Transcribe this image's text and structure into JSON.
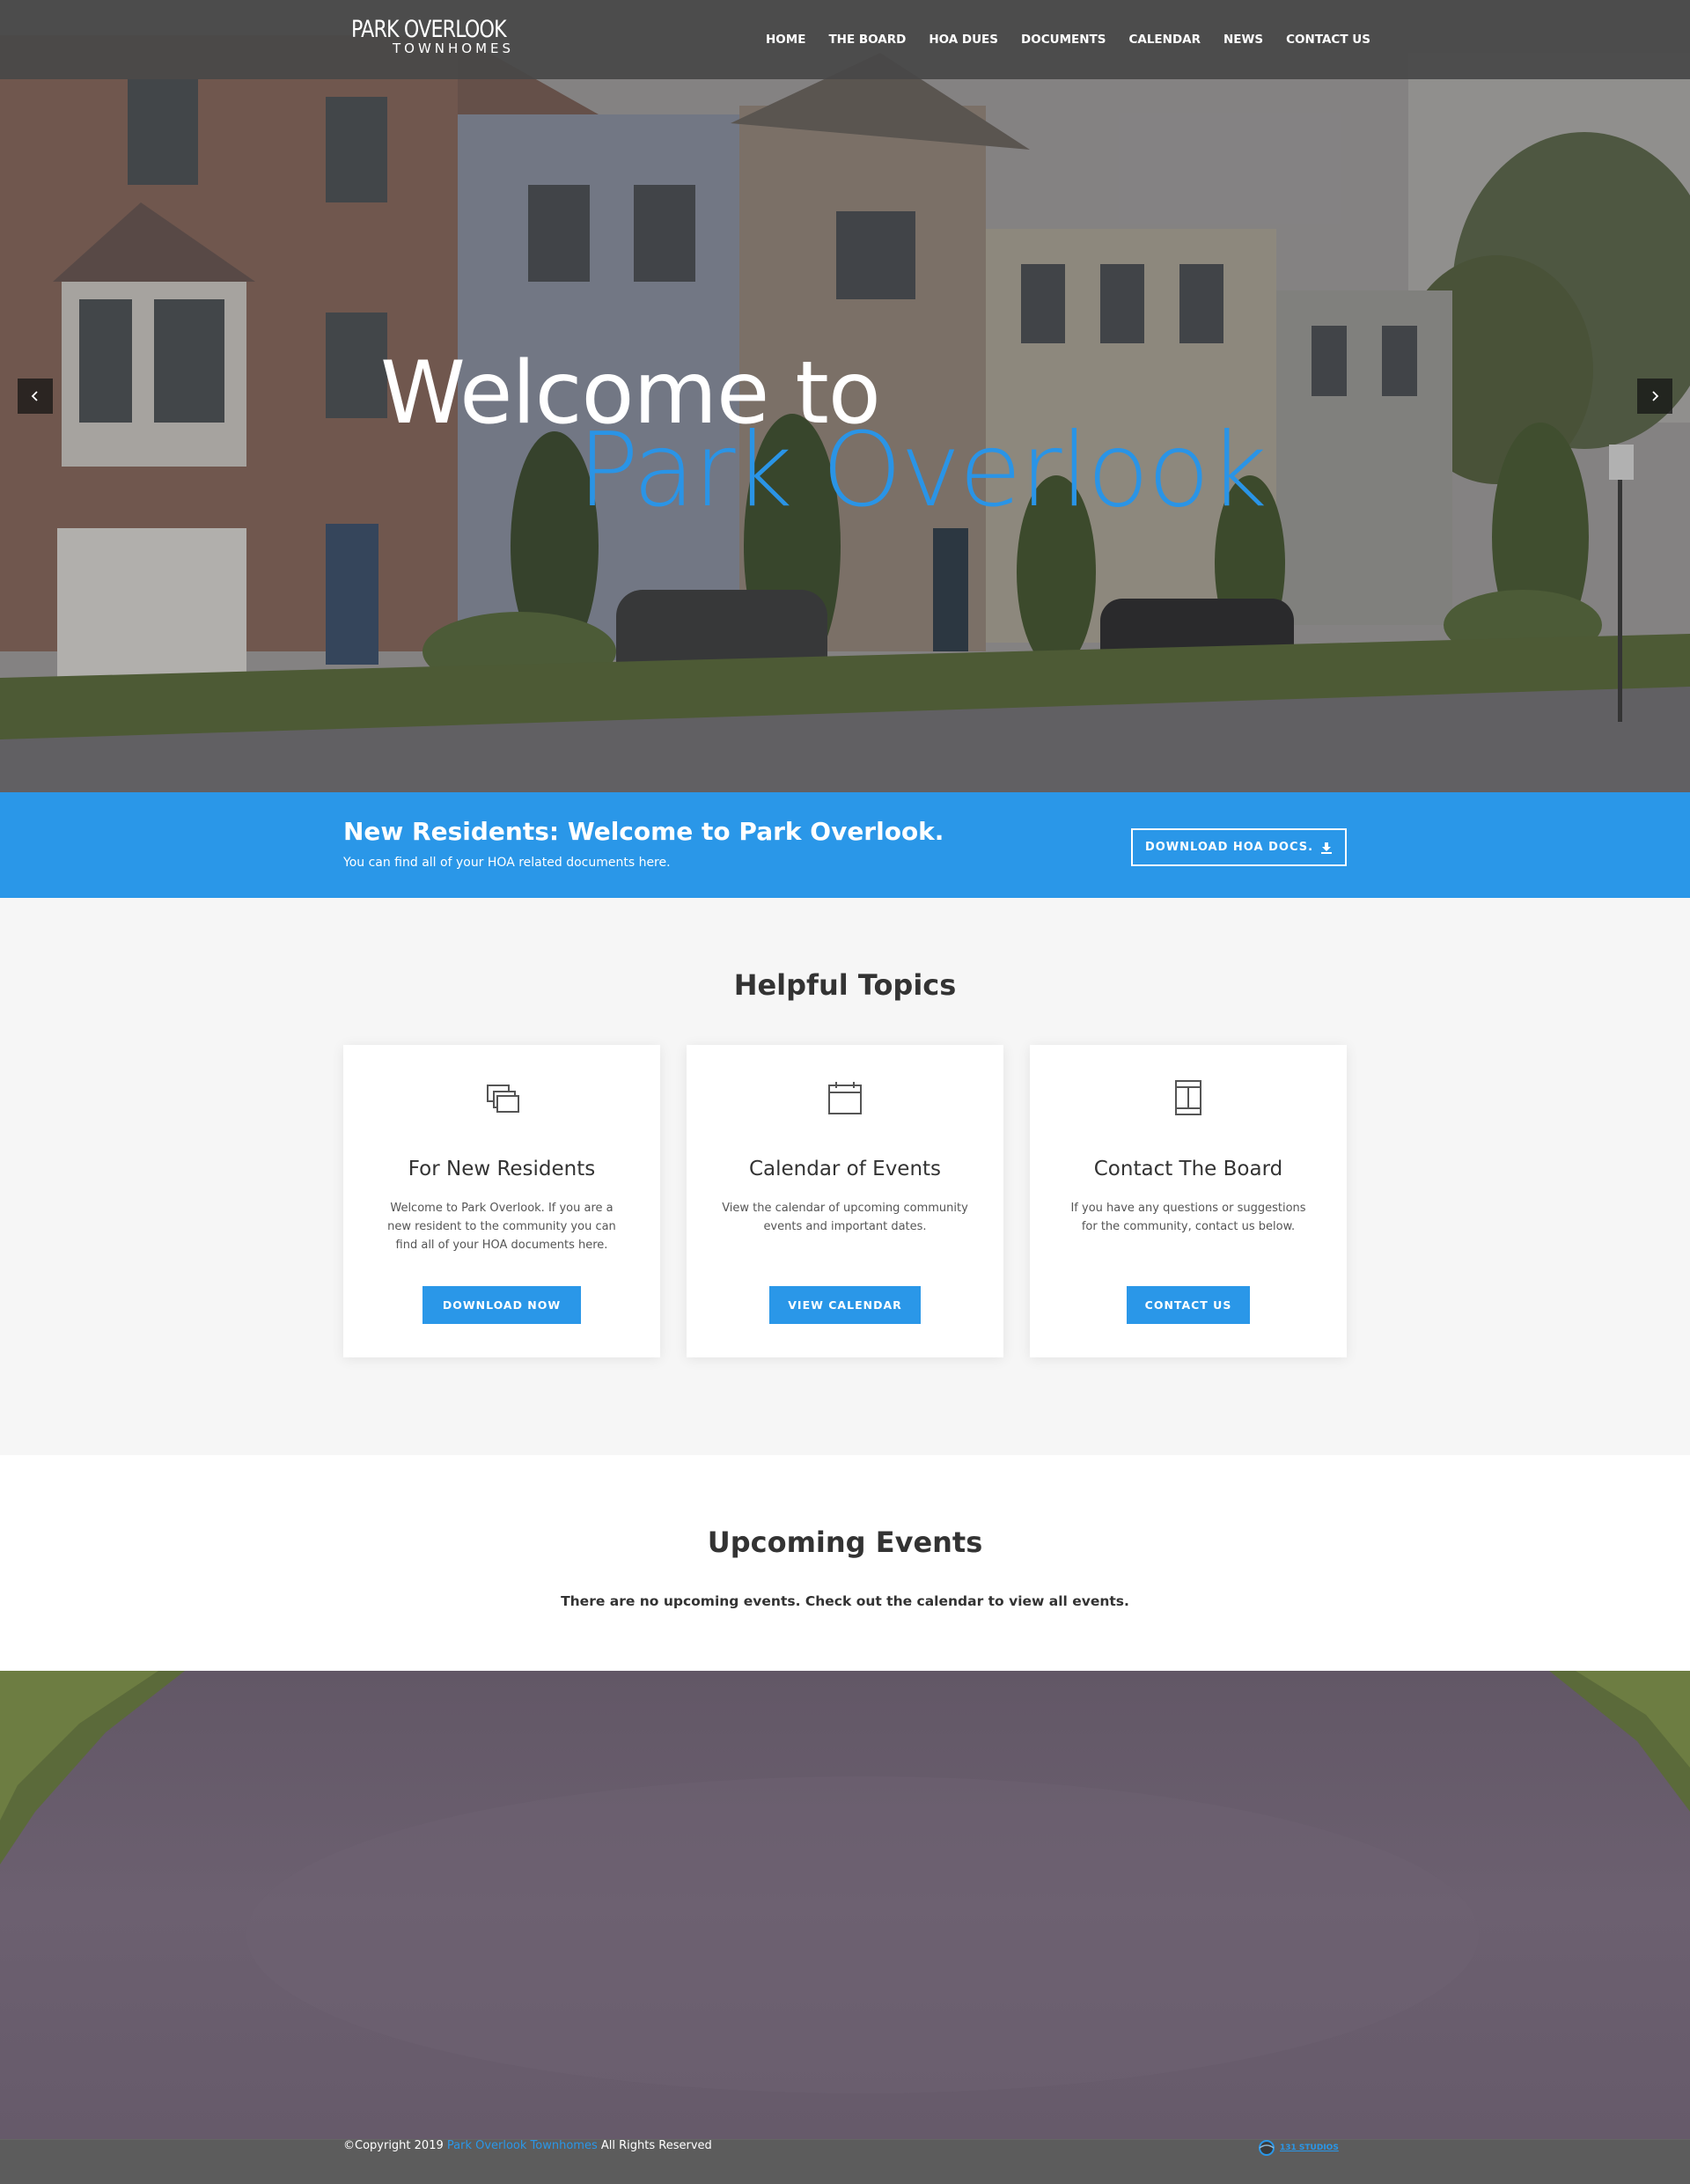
{
  "site": {
    "logo_main": "PARK OVERLOOK",
    "logo_sub": "TOWNHOMES"
  },
  "nav": {
    "items": [
      {
        "label": "HOME"
      },
      {
        "label": "THE BOARD"
      },
      {
        "label": "HOA DUES"
      },
      {
        "label": "DOCUMENTS"
      },
      {
        "label": "CALENDAR"
      },
      {
        "label": "NEWS"
      },
      {
        "label": "CONTACT US"
      }
    ]
  },
  "hero": {
    "title_line1": "Welcome to",
    "title_line2": "Park Overlook",
    "prev_icon": "chevron-left-icon",
    "next_icon": "chevron-right-icon"
  },
  "banner": {
    "heading_bold": "New Residents:",
    "heading_rest": " Welcome to Park Overlook.",
    "subtext": "You can find all of your HOA related documents here.",
    "button_label": "DOWNLOAD HOA DOCS.",
    "button_icon": "download-icon"
  },
  "topics": {
    "title": "Helpful Topics",
    "cards": [
      {
        "icon": "documents-icon",
        "title": "For New Residents",
        "text": "Welcome to Park Overlook. If you are a new resident to the community you can find all of your HOA documents here.",
        "button": "DOWNLOAD NOW"
      },
      {
        "icon": "calendar-icon",
        "title": "Calendar of Events",
        "text": "View the calendar of upcoming community events and important dates.",
        "button": "VIEW CALENDAR"
      },
      {
        "icon": "contact-book-icon",
        "title": "Contact The Board",
        "text": "If you have any questions or suggestions for the community, contact us below.",
        "button": "CONTACT US"
      }
    ]
  },
  "events": {
    "title": "Upcoming Events",
    "empty_text": "There are no upcoming events. Check out the calendar to view all events."
  },
  "footer": {
    "copyright_prefix": "©Copyright 2019 ",
    "copyright_link": "Park Overlook Townhomes",
    "copyright_suffix": " All Rights Reserved",
    "credit_logo_text": "131 STUDIOS"
  },
  "colors": {
    "accent": "#2a97e8",
    "header_bg": "#484848",
    "footer_bg": "#5c5c5c",
    "topics_bg": "#f6f6f6"
  }
}
